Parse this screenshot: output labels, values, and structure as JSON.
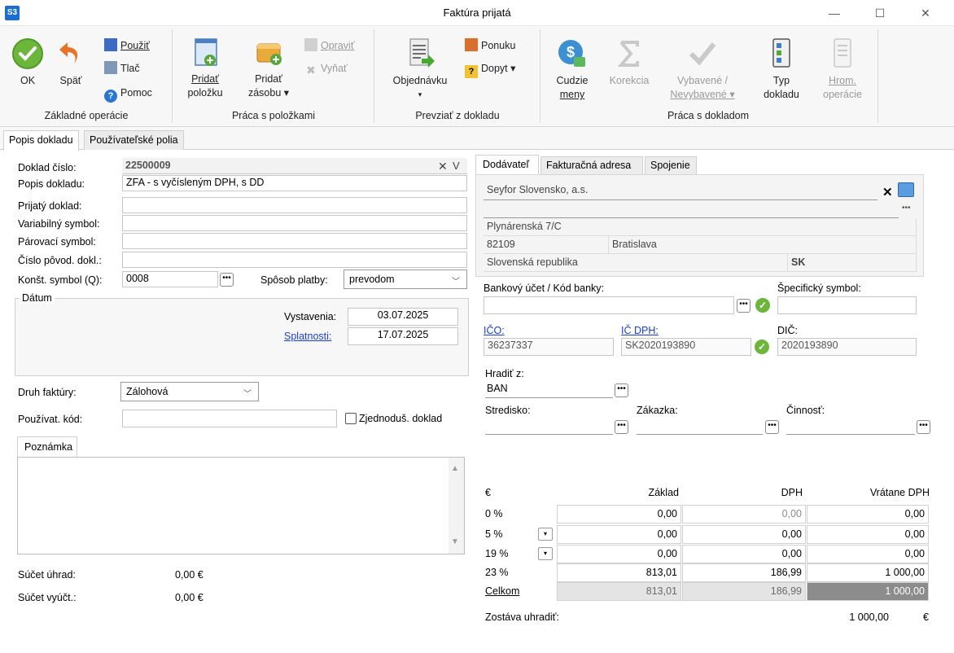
{
  "window": {
    "app_logo": "S3",
    "title": "Faktúra prijatá",
    "minimize": "—",
    "maximize": "☐",
    "close": "✕"
  },
  "ribbon": {
    "groups": {
      "basic": "Základné operácie",
      "items": "Práca s položkami",
      "take": "Prevziať z dokladu",
      "doc": "Práca s dokladom"
    },
    "ok": "OK",
    "back": "Späť",
    "use": "Použiť",
    "print": "Tlač",
    "help": "Pomoc",
    "add_item_1": "Pridať",
    "add_item_2": "položku",
    "add_stock_1": "Pridať",
    "add_stock_2": "zásobu ▾",
    "edit": "Opraviť",
    "remove": "Vyňať",
    "order_1": "Objednávku",
    "order_2": "▾",
    "offer": "Ponuku",
    "inquiry": "Dopyt ▾",
    "foreign_1": "Cudzie",
    "foreign_2": "meny",
    "correction": "Korekcia",
    "settled_1": "Vybavené /",
    "settled_2": "Nevybavené ▾",
    "doc_type_1": "Typ",
    "doc_type_2": "dokladu",
    "bulk_1": "Hrom.",
    "bulk_2": "operácie"
  },
  "tabs": {
    "description": "Popis dokladu",
    "user_fields": "Používateľské polia"
  },
  "form": {
    "doc_number_label": "Doklad číslo:",
    "doc_number": "22500009",
    "doc_desc_label": "Popis dokladu:",
    "doc_desc": "ZFA - s vyčísleným DPH, s  DD",
    "received_label": "Prijatý doklad:",
    "variable_label": "Variabilný symbol:",
    "pairing_label": "Párovací symbol:",
    "original_label": "Číslo pôvod. dokl.:",
    "const_label": "Konšt. symbol (Q):",
    "const_value": "0008",
    "payment_label": "Spôsob platby:",
    "payment_value": "prevodom",
    "date_group": "Dátum",
    "issued_label": "Vystavenia:",
    "issued": "03.07.2025",
    "due_label": "Splatnosti:",
    "due": "17.07.2025",
    "invoice_type_label": "Druh faktúry:",
    "invoice_type": "Zálohová",
    "user_code_label": "Používat. kód:",
    "simplified_label": "Zjednoduš. doklad",
    "note_tab": "Poznámka",
    "sum_payments_label": "Súčet úhrad:",
    "sum_payments": "0,00 €",
    "sum_settle_label": "Súčet vyúčt.:",
    "sum_settle": "0,00 €"
  },
  "supplier": {
    "tabs": {
      "supplier": "Dodávateľ",
      "billing": "Fakturačná adresa",
      "contact": "Spojenie"
    },
    "name": "Seyfor Slovensko, a.s.",
    "street": "Plynárenská 7/C",
    "zip": "82109",
    "city": "Bratislava",
    "country": "Slovenská republika",
    "country_code": "SK",
    "bank_label": "Bankový účet / Kód banky:",
    "specific_label": "Špecifický symbol:",
    "ico_label": "IČO:",
    "ico": "36237337",
    "icdph_label": "IČ DPH:",
    "icdph": "SK2020193890",
    "dic_label": "DIČ:",
    "dic": "2020193890",
    "pay_from_label": "Hradiť z:",
    "pay_from": "BAN",
    "center_label": "Stredisko:",
    "order_label": "Zákazka:",
    "activity_label": "Činnosť:"
  },
  "vat": {
    "currency": "€",
    "h_base": "Základ",
    "h_vat": "DPH",
    "h_total": "Vrátane DPH",
    "rows": [
      {
        "rate": "0 %",
        "base": "0,00",
        "vat": "0,00",
        "total": "0,00"
      },
      {
        "rate": "5 %",
        "base": "0,00",
        "vat": "0,00",
        "total": "0,00"
      },
      {
        "rate": "19 %",
        "base": "0,00",
        "vat": "0,00",
        "total": "0,00"
      },
      {
        "rate": "23 %",
        "base": "813,01",
        "vat": "186,99",
        "total": "1 000,00"
      }
    ],
    "sum_label": "Celkom",
    "sum_base": "813,01",
    "sum_vat": "186,99",
    "sum_total": "1 000,00",
    "remain_label": "Zostáva uhradiť:",
    "remain": "1 000,00",
    "remain_cur": "€"
  }
}
